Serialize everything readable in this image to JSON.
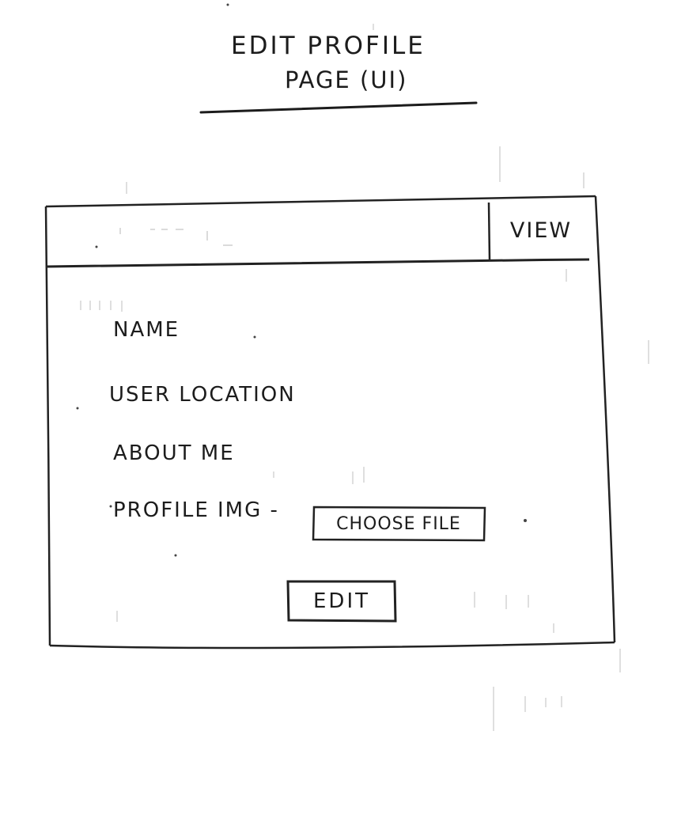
{
  "title": {
    "line1": "EDIT PROFILE",
    "line2": "PAGE (UI)"
  },
  "top_bar": {
    "view_label": "VIEW"
  },
  "form": {
    "fields": [
      {
        "label": "NAME"
      },
      {
        "label": "USER LOCATION"
      },
      {
        "label": "ABOUT ME"
      },
      {
        "label": "PROFILE IMG -"
      }
    ],
    "choose_file_label": "CHOOSE FILE",
    "edit_label": "EDIT"
  }
}
